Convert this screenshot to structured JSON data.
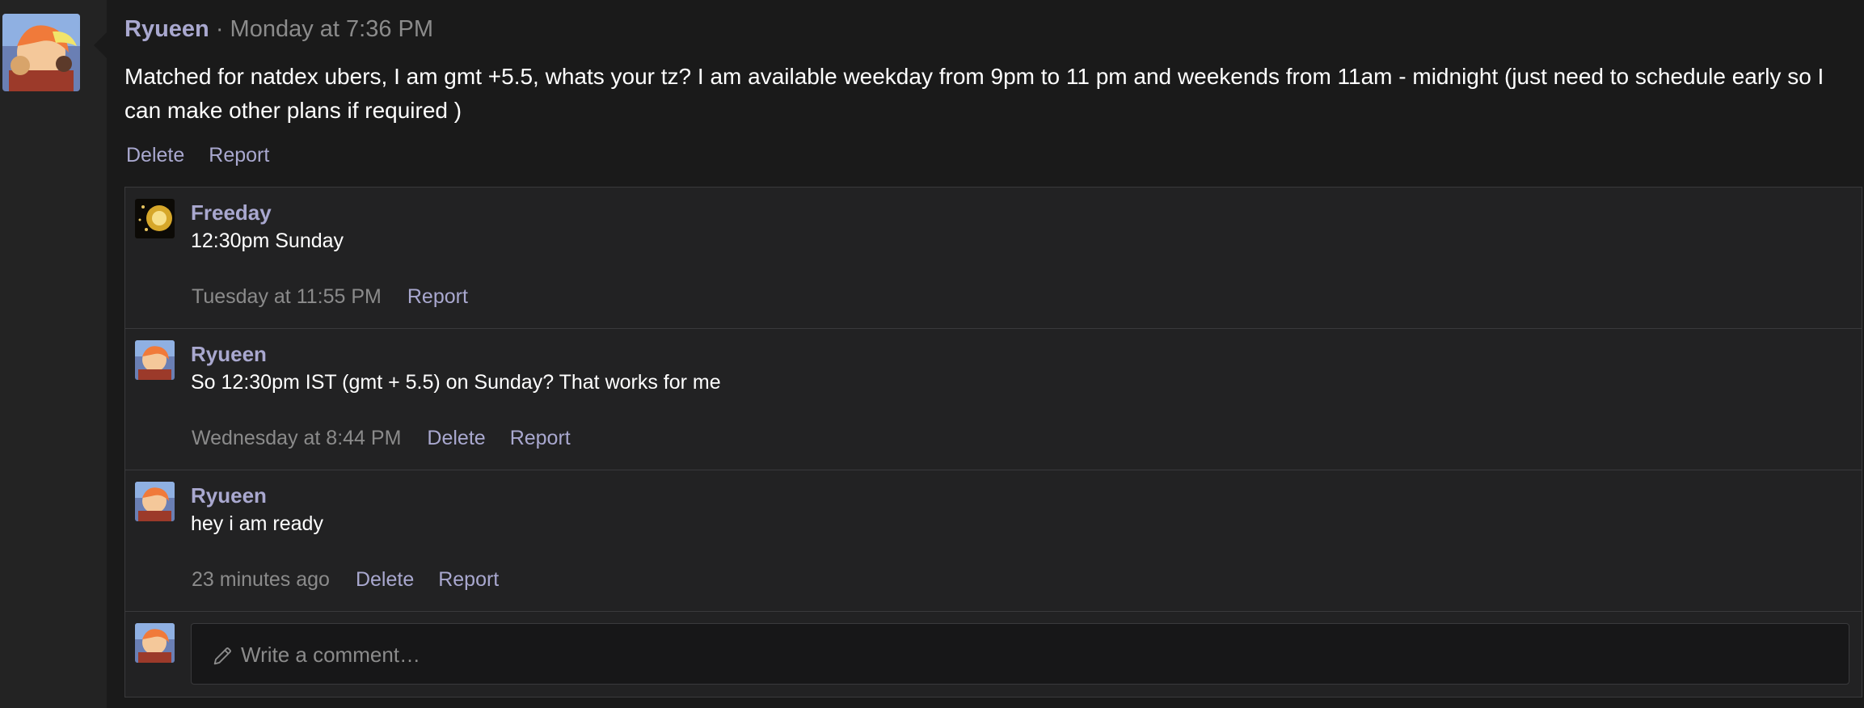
{
  "post": {
    "author": "Ryueen",
    "separator": " · ",
    "timestamp": "Monday at 7:36 PM",
    "body": "Matched for natdex ubers, I am gmt +5.5, whats your tz? I am available weekday from 9pm to 11 pm and weekends from 11am - midnight (just need to schedule early so I can make other plans if required )",
    "actions": {
      "delete": "Delete",
      "report": "Report"
    }
  },
  "comments": [
    {
      "author": "Freeday",
      "text": "12:30pm Sunday",
      "timestamp": "Tuesday at 11:55 PM",
      "actions": {
        "report": "Report"
      }
    },
    {
      "author": "Ryueen",
      "text": "So 12:30pm IST (gmt + 5.5) on Sunday? That works for me",
      "timestamp": "Wednesday at 8:44 PM",
      "actions": {
        "delete": "Delete",
        "report": "Report"
      }
    },
    {
      "author": "Ryueen",
      "text": "hey i am ready",
      "timestamp": "23 minutes ago",
      "actions": {
        "delete": "Delete",
        "report": "Report"
      }
    }
  ],
  "composer": {
    "placeholder": "Write a comment…",
    "icon": "pencil-icon"
  },
  "colors": {
    "link": "#a9a8cf",
    "muted": "#8b8b8b",
    "text": "#ffffff",
    "background": "#1a1a1a"
  }
}
